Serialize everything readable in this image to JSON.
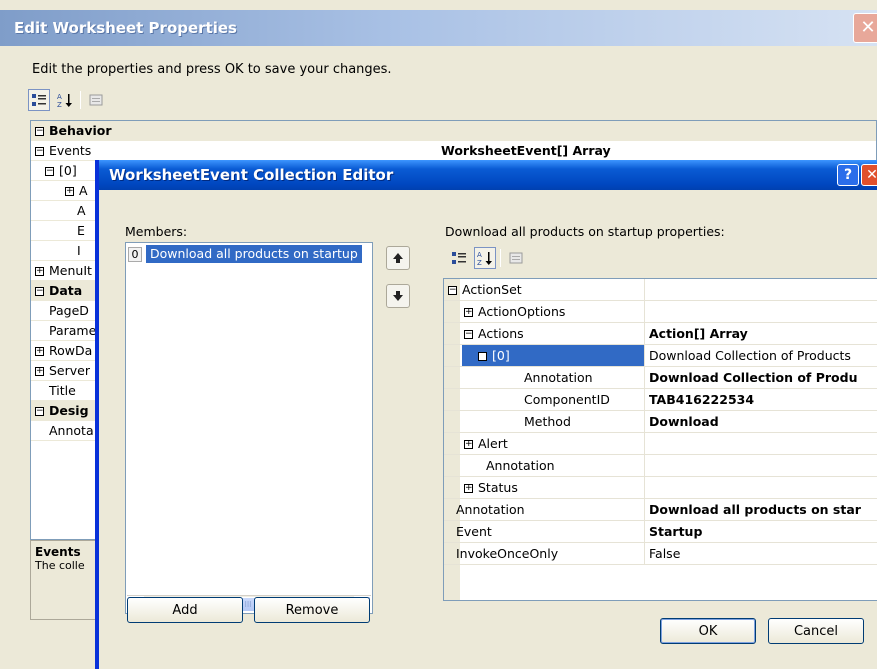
{
  "outer": {
    "title": "Edit Worksheet Properties",
    "close_glyph": "✕",
    "description": "Edit the properties and press OK to save your changes.",
    "grid_rows": [
      {
        "label": "Behavior",
        "category": true,
        "expander": "⊟"
      },
      {
        "label": "Events",
        "value": "WorksheetEvent[] Array",
        "expander": "⊟"
      },
      {
        "label": "[0]",
        "expander": "⊟"
      },
      {
        "label": "A",
        "expander": "⊞"
      },
      {
        "label": "A"
      },
      {
        "label": "E"
      },
      {
        "label": "I"
      },
      {
        "label": "MenuIt",
        "expander": "⊞"
      },
      {
        "label": "Data",
        "category": true,
        "expander": "⊟"
      },
      {
        "label": "PageD"
      },
      {
        "label": "Parame"
      },
      {
        "label": "RowDa",
        "expander": "⊞"
      },
      {
        "label": "Server",
        "expander": "⊞"
      },
      {
        "label": "Title"
      },
      {
        "label": "Desig",
        "category": true,
        "expander": "⊟"
      },
      {
        "label": "Annota"
      }
    ],
    "help_title": "Events",
    "help_text": "The colle"
  },
  "dialog": {
    "title": "WorksheetEvent Collection Editor",
    "help_glyph": "?",
    "close_glyph": "✕",
    "members_label": "Members:",
    "members": [
      {
        "index": "0",
        "text": "Download all products on startup"
      }
    ],
    "scroll_left": "◀",
    "scroll_right": "▶",
    "scroll_grip": "III",
    "move_up": "🡅",
    "move_down": "🡇",
    "add_label": "Add",
    "remove_label": "Remove",
    "props_label": "Download all products on startup properties:",
    "ok_label": "OK",
    "cancel_label": "Cancel",
    "props": [
      {
        "name": "ActionSet",
        "level": 0,
        "expander": "⊟",
        "value": ""
      },
      {
        "name": "ActionOptions",
        "level": 1,
        "expander": "⊞",
        "value": ""
      },
      {
        "name": "Actions",
        "level": 1,
        "expander": "⊟",
        "value": "Action[] Array",
        "bold": true
      },
      {
        "name": "[0]",
        "level": 2,
        "expander": "⊟",
        "value": "Download Collection of Products",
        "selected": true
      },
      {
        "name": "Annotation",
        "level": 3,
        "value": "Download Collection of Produ",
        "bold": true
      },
      {
        "name": "ComponentID",
        "level": 3,
        "value": "TAB416222534",
        "bold": true
      },
      {
        "name": "Method",
        "level": 3,
        "value": "Download",
        "bold": true
      },
      {
        "name": "Alert",
        "level": 1,
        "expander": "⊞",
        "value": ""
      },
      {
        "name": "Annotation",
        "level": 2,
        "value": ""
      },
      {
        "name": "Status",
        "level": 1,
        "expander": "⊞",
        "value": ""
      },
      {
        "name": "Annotation",
        "level": 0,
        "value": "Download all products on star",
        "bold": true,
        "noexp": true
      },
      {
        "name": "Event",
        "level": 0,
        "value": "Startup",
        "bold": true,
        "noexp": true
      },
      {
        "name": "InvokeOnceOnly",
        "level": 0,
        "value": "False",
        "noexp": true
      }
    ]
  },
  "colors": {
    "xp_blue": "#0a5bd4",
    "selection": "#316ac5",
    "dialog_bg": "#ece9d8"
  }
}
